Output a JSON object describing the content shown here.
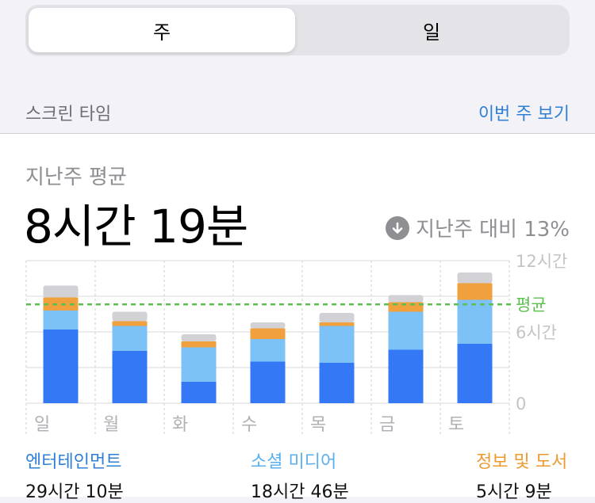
{
  "segmented": {
    "week_label": "주",
    "day_label": "일"
  },
  "section": {
    "title": "스크린 타임",
    "link": "이번 주 보기"
  },
  "summary": {
    "avg_label": "지난주 평균",
    "avg_value": "8시간 19분",
    "compare_text": "지난주 대비 13%",
    "compare_icon": "down-arrow-circle-icon"
  },
  "chart_data": {
    "type": "bar",
    "categories": [
      "일",
      "월",
      "화",
      "수",
      "목",
      "금",
      "토"
    ],
    "y_ticks": [
      {
        "value": 12,
        "label": "12시간"
      },
      {
        "value": 6,
        "label": "6시간"
      },
      {
        "value": 0,
        "label": "0"
      }
    ],
    "ylim": [
      0,
      12
    ],
    "average": {
      "value": 8.32,
      "label": "평균",
      "color": "#5cbf4f"
    },
    "series": [
      {
        "name": "엔터테인먼트",
        "color": "#3478f6",
        "values": [
          6.2,
          4.4,
          1.8,
          3.5,
          3.4,
          4.5,
          5.0
        ]
      },
      {
        "name": "소셜 미디어",
        "color": "#7cc2f7",
        "values": [
          1.6,
          2.1,
          2.9,
          1.9,
          3.1,
          3.2,
          3.7
        ]
      },
      {
        "name": "정보 및 도서",
        "color": "#f0a03c",
        "values": [
          1.1,
          0.4,
          0.5,
          0.9,
          0.3,
          0.8,
          1.4
        ]
      },
      {
        "name": "",
        "color": "#d1d1d6",
        "values": [
          1.0,
          0.8,
          0.6,
          0.5,
          0.8,
          0.6,
          0.9
        ]
      }
    ]
  },
  "legend": [
    {
      "name": "엔터테인먼트",
      "value": "29시간 10분",
      "color": "#2f7fd7"
    },
    {
      "name": "소셜 미디어",
      "value": "18시간 46분",
      "color": "#5ab0ef"
    },
    {
      "name": "정보 및 도서",
      "value": "5시간 9분",
      "color": "#ee9a2e"
    }
  ]
}
